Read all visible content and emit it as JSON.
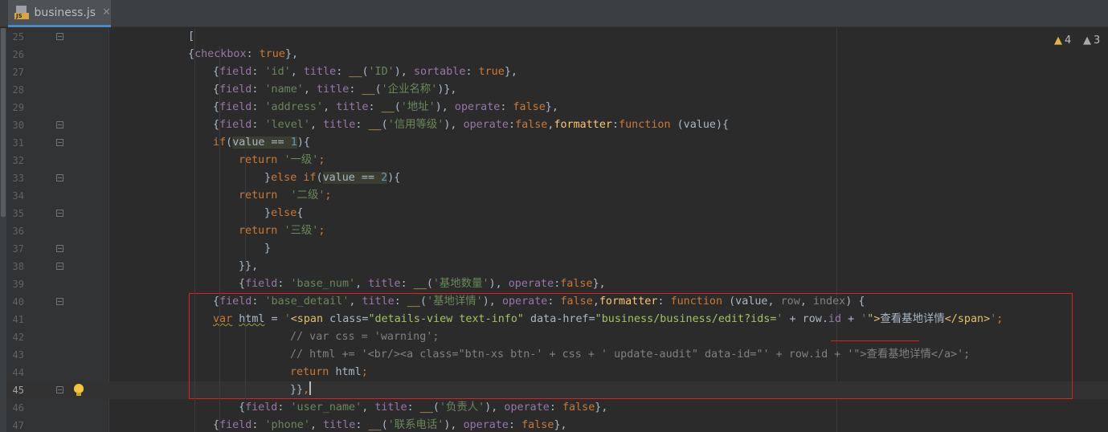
{
  "tab": {
    "label": "business.js",
    "icon": "js-file-icon",
    "close": "✕"
  },
  "inspections": {
    "warnings": "4",
    "weak_warnings": "3"
  },
  "lines": [
    {
      "num": "25",
      "fold": true,
      "tokens": [
        [
          "",
          "["
        ]
      ]
    },
    {
      "num": "26",
      "tokens": [
        [
          "",
          "{"
        ],
        [
          "p",
          "checkbox"
        ],
        [
          "",
          ": "
        ],
        [
          "k",
          "true"
        ],
        [
          "",
          "},"
        ]
      ]
    },
    {
      "num": "27",
      "tokens": [
        [
          "",
          "{"
        ],
        [
          "p",
          "field"
        ],
        [
          "",
          ": "
        ],
        [
          "s",
          "'id'"
        ],
        [
          "",
          ", "
        ],
        [
          "p",
          "title"
        ],
        [
          "",
          ": "
        ],
        [
          "fn",
          "__"
        ],
        [
          "",
          "("
        ],
        [
          "s",
          "'ID'"
        ],
        [
          "",
          "), "
        ],
        [
          "p",
          "sortable"
        ],
        [
          "",
          ": "
        ],
        [
          "k",
          "true"
        ],
        [
          "",
          "},"
        ]
      ]
    },
    {
      "num": "28",
      "tokens": [
        [
          "",
          "{"
        ],
        [
          "p",
          "field"
        ],
        [
          "",
          ": "
        ],
        [
          "s",
          "'name'"
        ],
        [
          "",
          ", "
        ],
        [
          "p",
          "title"
        ],
        [
          "",
          ": "
        ],
        [
          "fn",
          "__"
        ],
        [
          "",
          "("
        ],
        [
          "s",
          "'企业名称'"
        ],
        [
          "",
          ")},"
        ]
      ]
    },
    {
      "num": "29",
      "tokens": [
        [
          "",
          "{"
        ],
        [
          "p",
          "field"
        ],
        [
          "",
          ": "
        ],
        [
          "s",
          "'address'"
        ],
        [
          "",
          ", "
        ],
        [
          "p",
          "title"
        ],
        [
          "",
          ": "
        ],
        [
          "fn",
          "__"
        ],
        [
          "",
          "("
        ],
        [
          "s",
          "'地址'"
        ],
        [
          "",
          "), "
        ],
        [
          "p",
          "operate"
        ],
        [
          "",
          ": "
        ],
        [
          "k",
          "false"
        ],
        [
          "",
          "},"
        ]
      ]
    },
    {
      "num": "30",
      "fold": true,
      "tokens": [
        [
          "",
          "{"
        ],
        [
          "p",
          "field"
        ],
        [
          "",
          ": "
        ],
        [
          "s",
          "'level'"
        ],
        [
          "",
          ", "
        ],
        [
          "p",
          "title"
        ],
        [
          "",
          ": "
        ],
        [
          "fn",
          "__"
        ],
        [
          "",
          "("
        ],
        [
          "s",
          "'信用等级'"
        ],
        [
          "",
          "), "
        ],
        [
          "p",
          "operate"
        ],
        [
          "",
          ":"
        ],
        [
          "k",
          "false"
        ],
        [
          "",
          ","
        ],
        [
          "fn",
          "formatter"
        ],
        [
          "",
          ":"
        ],
        [
          "k",
          "function "
        ],
        [
          "",
          "(value){"
        ]
      ]
    },
    {
      "num": "31",
      "fold": true,
      "tokens": [
        [
          "k",
          "if"
        ],
        [
          "",
          "("
        ],
        [
          "hl",
          "value == "
        ],
        [
          "hln",
          "1"
        ],
        [
          "",
          ")"
        ],
        [
          "",
          "{"
        ]
      ]
    },
    {
      "num": "32",
      "tokens": [
        [
          "k",
          "return "
        ],
        [
          "s",
          "'一级'"
        ],
        [
          "k",
          ";"
        ]
      ]
    },
    {
      "num": "33",
      "fold": true,
      "tokens": [
        [
          "",
          "}"
        ],
        [
          "k",
          "else if"
        ],
        [
          "",
          "("
        ],
        [
          "hl",
          "value == "
        ],
        [
          "hln",
          "2"
        ],
        [
          "",
          ")"
        ],
        [
          "",
          "{"
        ]
      ]
    },
    {
      "num": "34",
      "tokens": [
        [
          "k",
          "return  "
        ],
        [
          "s",
          "'二级'"
        ],
        [
          "k",
          ";"
        ]
      ]
    },
    {
      "num": "35",
      "fold": true,
      "tokens": [
        [
          "",
          "}"
        ],
        [
          "k",
          "else"
        ],
        [
          "",
          "{"
        ]
      ]
    },
    {
      "num": "36",
      "tokens": [
        [
          "k",
          "return "
        ],
        [
          "s",
          "'三级'"
        ],
        [
          "k",
          ";"
        ]
      ]
    },
    {
      "num": "37",
      "fold": true,
      "tokens": [
        [
          "",
          "}"
        ]
      ]
    },
    {
      "num": "38",
      "fold": true,
      "tokens": [
        [
          "",
          "}},"
        ]
      ]
    },
    {
      "num": "39",
      "tokens": [
        [
          "",
          "{"
        ],
        [
          "p",
          "field"
        ],
        [
          "",
          ": "
        ],
        [
          "s",
          "'base_num'"
        ],
        [
          "",
          ", "
        ],
        [
          "p",
          "title"
        ],
        [
          "",
          ": "
        ],
        [
          "fn",
          "__"
        ],
        [
          "",
          "("
        ],
        [
          "s",
          "'基地数量'"
        ],
        [
          "",
          "), "
        ],
        [
          "p",
          "operate"
        ],
        [
          "",
          ":"
        ],
        [
          "k",
          "false"
        ],
        [
          "",
          "},"
        ]
      ]
    },
    {
      "num": "40",
      "fold": true,
      "tokens": [
        [
          "",
          "{"
        ],
        [
          "p",
          "field"
        ],
        [
          "",
          ": "
        ],
        [
          "s",
          "'base_detail'"
        ],
        [
          "",
          ", "
        ],
        [
          "p",
          "title"
        ],
        [
          "",
          ": "
        ],
        [
          "fn",
          "__"
        ],
        [
          "",
          "("
        ],
        [
          "s",
          "'基地详情'"
        ],
        [
          "",
          "), "
        ],
        [
          "p",
          "operate"
        ],
        [
          "",
          ": "
        ],
        [
          "k",
          "false"
        ],
        [
          "",
          ","
        ],
        [
          "fn",
          "formatter"
        ],
        [
          "",
          ": "
        ],
        [
          "k",
          "function "
        ],
        [
          "",
          "(value, "
        ],
        [
          "c",
          "row"
        ],
        [
          "",
          ", "
        ],
        [
          "c",
          "index"
        ],
        [
          "",
          ") {"
        ]
      ]
    },
    {
      "num": "41",
      "tokens": [
        [
          "ksq",
          "var"
        ],
        [
          "",
          " "
        ],
        [
          "lvsq",
          "html"
        ],
        [
          "",
          " = "
        ],
        [
          "s",
          "'"
        ],
        [
          "t",
          "<span "
        ],
        [
          "",
          "class="
        ],
        [
          "av",
          "\"details-view text-info\""
        ],
        [
          "",
          " data-href="
        ],
        [
          "av",
          "\"business/business/edit?ids="
        ],
        [
          "s",
          "'"
        ],
        [
          "",
          " + row."
        ],
        [
          "p",
          "id"
        ],
        [
          "",
          " + "
        ],
        [
          "s",
          "'"
        ],
        [
          "av",
          "\""
        ],
        [
          "t",
          ">"
        ],
        [
          "",
          "查看基地详情"
        ],
        [
          "t",
          "</span>"
        ],
        [
          "s",
          "'"
        ],
        [
          "k",
          ";"
        ]
      ]
    },
    {
      "num": "42",
      "tokens": [
        [
          "c",
          "// var css = 'warning';"
        ]
      ]
    },
    {
      "num": "43",
      "tokens": [
        [
          "c",
          "// html += '<br/><a class=\"btn-xs btn-' + css + ' update-audit\" data-id=\"' + row.id + '\">查看基地详情</a>';"
        ]
      ]
    },
    {
      "num": "44",
      "tokens": [
        [
          "k",
          "return "
        ],
        [
          "",
          "html"
        ],
        [
          "k",
          ";"
        ]
      ]
    },
    {
      "num": "45",
      "fold": true,
      "current": true,
      "bulb": true,
      "caret": true,
      "tokens": [
        [
          "",
          "}}"
        ],
        [
          "k",
          ","
        ]
      ]
    },
    {
      "num": "46",
      "tokens": [
        [
          "",
          "{"
        ],
        [
          "p",
          "field"
        ],
        [
          "",
          ": "
        ],
        [
          "s",
          "'user_name'"
        ],
        [
          "",
          ", "
        ],
        [
          "p",
          "title"
        ],
        [
          "",
          ": "
        ],
        [
          "fn",
          "__"
        ],
        [
          "",
          "("
        ],
        [
          "s",
          "'负责人'"
        ],
        [
          "",
          "), "
        ],
        [
          "p",
          "operate"
        ],
        [
          "",
          ": "
        ],
        [
          "k",
          "false"
        ],
        [
          "",
          "},"
        ]
      ]
    },
    {
      "num": "47",
      "tokens": [
        [
          "",
          "{"
        ],
        [
          "p",
          "field"
        ],
        [
          "",
          ": "
        ],
        [
          "s",
          "'phone'"
        ],
        [
          "",
          ", "
        ],
        [
          "p",
          "title"
        ],
        [
          "",
          ": "
        ],
        [
          "fn",
          "__"
        ],
        [
          "",
          "("
        ],
        [
          "s",
          "'联系电话'"
        ],
        [
          "",
          "), "
        ],
        [
          "p",
          "operate"
        ],
        [
          "",
          ": "
        ],
        [
          "k",
          "false"
        ],
        [
          "",
          "},"
        ]
      ]
    }
  ],
  "colors": {
    "editor_bg": "#2b2b2b",
    "keyword": "#cc7832",
    "string": "#6a8759",
    "property": "#9876aa",
    "function": "#ffc66d",
    "number": "#6897bb",
    "comment": "#808080",
    "annotation_box": "#e02020"
  }
}
